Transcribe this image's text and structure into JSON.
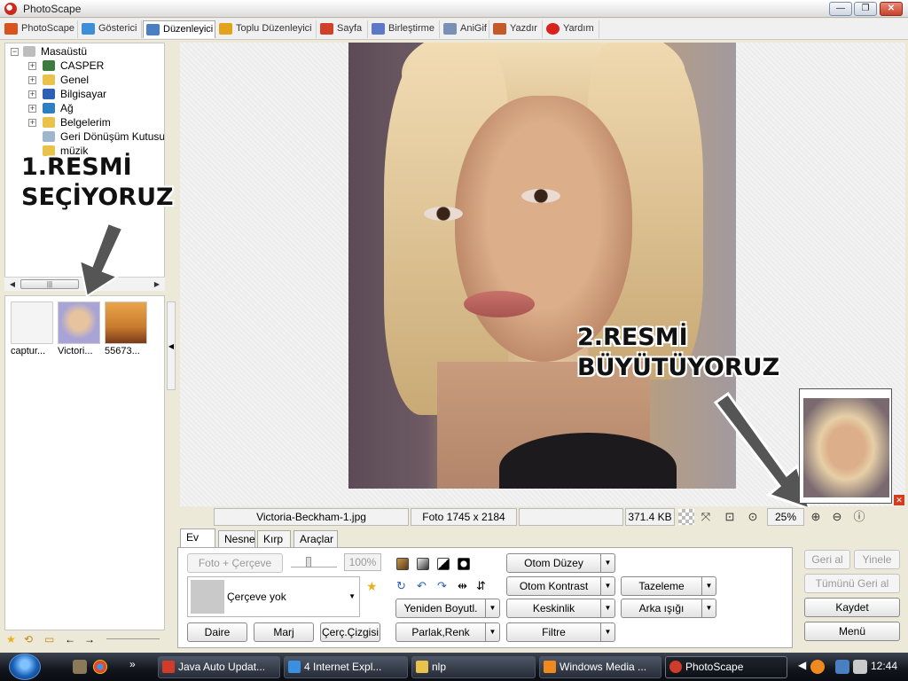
{
  "window": {
    "title": "PhotoScape",
    "buttons": {
      "min": "—",
      "max": "❐",
      "close": "✕"
    }
  },
  "tabs": [
    {
      "label": "PhotoScape",
      "color": "#d8541e"
    },
    {
      "label": "Gösterici",
      "color": "#3c8fd6"
    },
    {
      "label": "Düzenleyici",
      "color": "#4a7fc1"
    },
    {
      "label": "Toplu Düzenleyici",
      "color": "#e3a11c"
    },
    {
      "label": "Sayfa",
      "color": "#d3402a"
    },
    {
      "label": "Birleştirme",
      "color": "#5c78c7"
    },
    {
      "label": "AniGif",
      "color": "#7a8fb5"
    },
    {
      "label": "Yazdır",
      "color": "#c45a2a"
    },
    {
      "label": "Yardım",
      "color": "#d7231c"
    }
  ],
  "tree": {
    "root": "Masaüstü",
    "items": [
      {
        "label": "CASPER",
        "expandable": true,
        "icon_color": "#3d7a3d"
      },
      {
        "label": "Genel",
        "expandable": true,
        "icon_color": "#e8c24a"
      },
      {
        "label": "Bilgisayar",
        "expandable": true,
        "icon_color": "#2d5fb3"
      },
      {
        "label": "Ağ",
        "expandable": true,
        "icon_color": "#2d7fc1"
      },
      {
        "label": "Belgelerim",
        "expandable": true,
        "icon_color": "#e8c24a"
      },
      {
        "label": "Geri Dönüşüm Kutusu",
        "expandable": false,
        "icon_color": "#9fb6cf"
      },
      {
        "label": "müzik",
        "expandable": false,
        "icon_color": "#e8c24a"
      }
    ]
  },
  "thumbnails": [
    {
      "caption": "captur...",
      "color": "#f4f4f4"
    },
    {
      "caption": "Victori...",
      "color": "#a9a4d6"
    },
    {
      "caption": "55673...",
      "color": "#c97b2e"
    }
  ],
  "annotations": {
    "step1_line1": "1.RESMİ",
    "step1_line2": "SEÇİYORUZ",
    "step2_line1": "2.RESMİ",
    "step2_line2": "BÜYÜTÜYORUZ"
  },
  "status": {
    "filename": "Victoria-Beckham-1.jpg",
    "dimensions": "Foto 1745 x 2184",
    "filesize": "371.4 KB",
    "zoom": "25%"
  },
  "panel": {
    "tabs": [
      "Ev",
      "Nesne",
      "Kırp",
      "Araçlar"
    ],
    "foto_cerceve": "Foto + Çerçeve",
    "opacity": "100%",
    "frame": "Çerçeve yok",
    "buttons": {
      "daire": "Daire",
      "marj": "Marj",
      "cerc_cizgisi": "Çerç.Çizgisi",
      "otom_duzey": "Otom Düzey",
      "otom_kontrast": "Otom Kontrast",
      "keskinlik": "Keskinlik",
      "filtre": "Filtre",
      "yeniden_boyutl": "Yeniden Boyutl.",
      "parlak_renk": "Parlak,Renk",
      "tazeleme": "Tazeleme",
      "arka_isigi": "Arka ışığı"
    }
  },
  "right_buttons": {
    "undo": "Geri al",
    "redo": "Yinele",
    "undo_all": "Tümünü Geri al",
    "save": "Kaydet",
    "menu": "Menü"
  },
  "taskbar": {
    "tasks": [
      {
        "label": "Java Auto Updat...",
        "color": "#d23b2a"
      },
      {
        "label": "4 Internet Expl...",
        "color": "#3b8fe0"
      },
      {
        "label": "nlp",
        "color": "#e8c24a"
      },
      {
        "label": "Windows Media ...",
        "color": "#f08a1e"
      },
      {
        "label": "PhotoScape",
        "color": "#d23b2a"
      }
    ],
    "clock": "12:44"
  }
}
